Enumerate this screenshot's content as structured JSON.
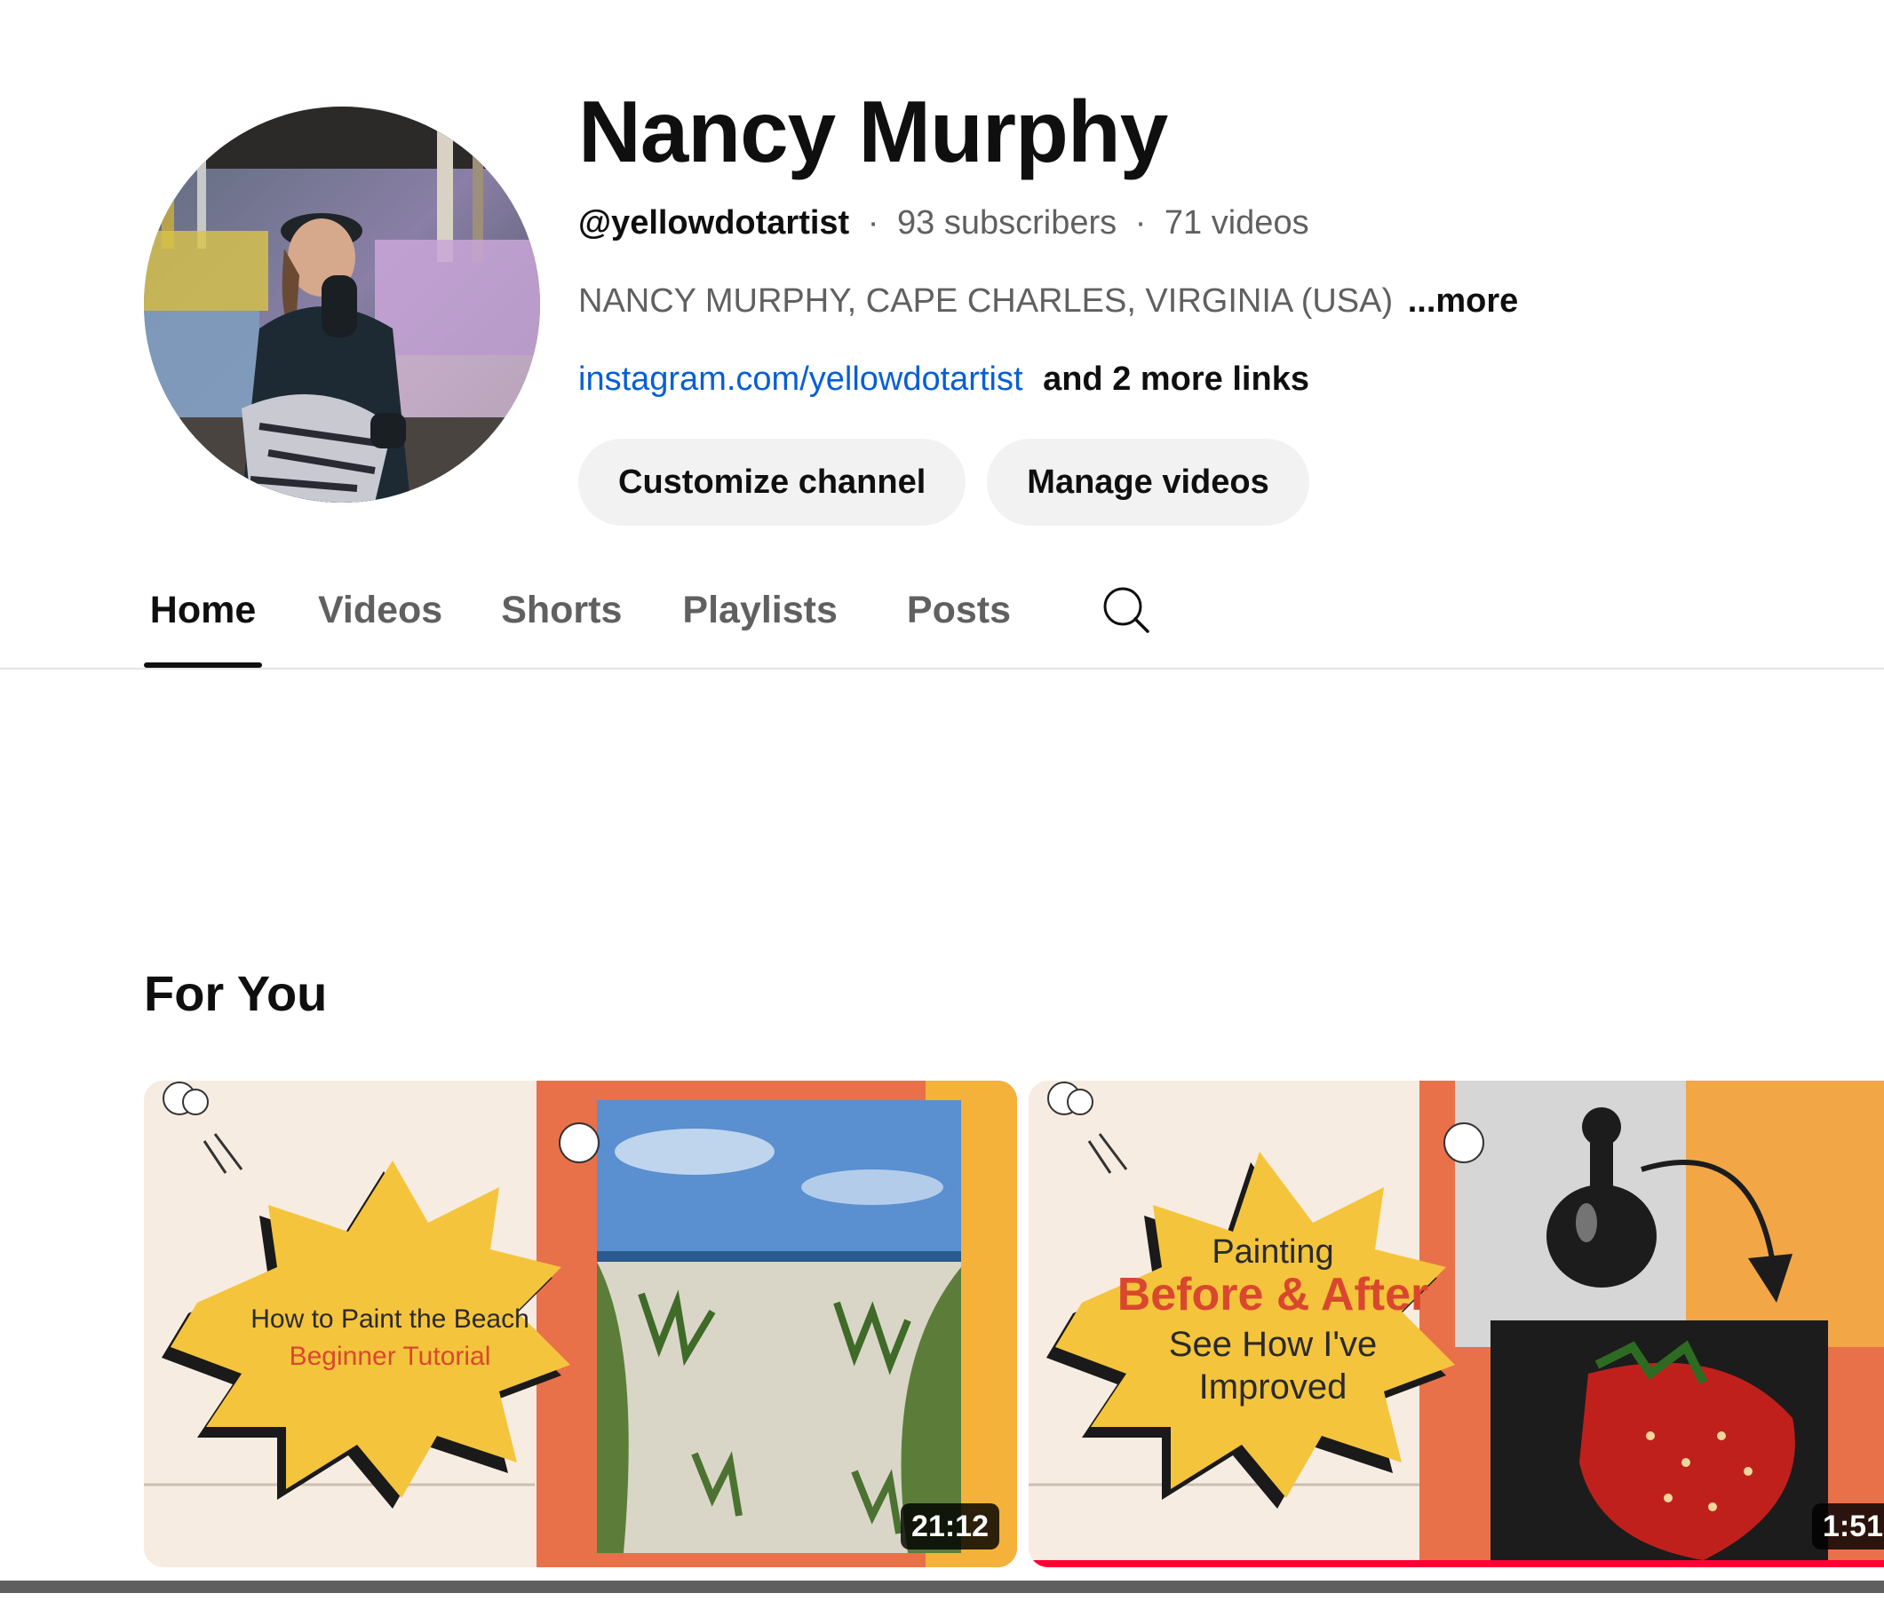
{
  "channel": {
    "name": "Nancy Murphy",
    "handle": "@yellowdotartist",
    "separator": "·",
    "subscribers": "93 subscribers",
    "videos": "71 videos",
    "description": "NANCY MURPHY, CAPE CHARLES, VIRGINIA (USA)",
    "more_label": "...more",
    "link_text": "instagram.com/yellowdotartist",
    "more_links": "and 2 more links",
    "customize_label": "Customize channel",
    "manage_label": "Manage videos"
  },
  "tabs": [
    {
      "label": "Home",
      "active": true
    },
    {
      "label": "Videos",
      "active": false
    },
    {
      "label": "Shorts",
      "active": false
    },
    {
      "label": "Playlists",
      "active": false
    },
    {
      "label": "Posts",
      "active": false
    }
  ],
  "search_icon": "search-icon",
  "section": {
    "title": "For You"
  },
  "videos": [
    {
      "thumb_line1": "How to Paint the Beach",
      "thumb_line2": "Beginner Tutorial",
      "duration": "21:12",
      "watch_progress": 0
    },
    {
      "thumb_line1": "Painting",
      "thumb_line2": "Before & After",
      "thumb_line3": "See How I've",
      "thumb_line4": "Improved",
      "duration": "1:51",
      "watch_progress": 1.0
    }
  ],
  "colors": {
    "accent_link": "#065fd4",
    "thumb_yellow": "#f4c43c",
    "thumb_cream": "#f7ece1",
    "thumb_red": "#e0432e",
    "progress_red": "#ff0033"
  }
}
